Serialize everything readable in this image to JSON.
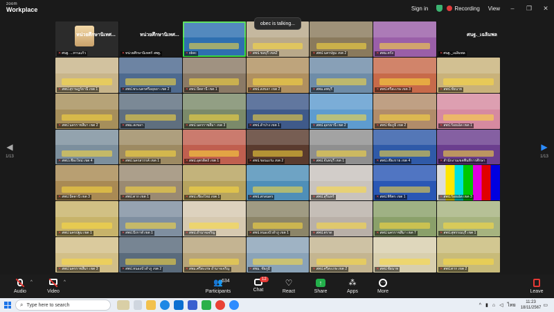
{
  "app": {
    "brand_line1": "zoom",
    "brand_line2": "Workplace"
  },
  "topbar": {
    "sign_in": "Sign in",
    "recording": "Recording",
    "view": "View",
    "minimize": "–",
    "restore": "❐",
    "close": "✕"
  },
  "talking": "obec is talking...",
  "nav": {
    "left_page": "1/13",
    "right_page": "1/13"
  },
  "tiles": [
    {
      "label": "ศนฐ. ...ทานแก้ว",
      "kind": "presenter",
      "color": "#2b2b2b",
      "banner": "หน่วยศึกษานิเทศ..."
    },
    {
      "label": "หน่วยศึกษานิเทศก์ สพฐ.",
      "kind": "banner",
      "color": "#1a1a1a",
      "banner": "หน่วยศึกษานิเทศ..."
    },
    {
      "label": "obec",
      "kind": "active",
      "color": "#2e6fb0"
    },
    {
      "label": "สพป.ชลบุรี เขต2",
      "kind": "room",
      "color": "#b9a98a"
    },
    {
      "label": "สพป.นครปฐม เขต 2",
      "kind": "room",
      "color": "#8a7a5c"
    },
    {
      "label": "สพม.ตรัง",
      "kind": "room",
      "color": "#9a5fa8"
    },
    {
      "label": "ศนฐ._เฉลิมพล",
      "kind": "banner",
      "color": "#1a1a1a",
      "banner": "ศนฐ._เฉลิมพล"
    },
    {
      "label": "สพป.สุราษฎร์ธานี เขต 1",
      "kind": "room",
      "color": "#c8b58a"
    },
    {
      "label": "สพป.พระนครศรีอยุธยา เขต 2",
      "kind": "room",
      "color": "#4e6a8f"
    },
    {
      "label": "สพป.ปัตตานี เขต 1",
      "kind": "room",
      "color": "#8b7a66"
    },
    {
      "label": "สพป.สงขลา เขต 2",
      "kind": "room",
      "color": "#b09060"
    },
    {
      "label": "สพม.ลพบุรี",
      "kind": "room",
      "color": "#6e8ca8"
    },
    {
      "label": "สพป.ศรีสะเกษ เขต 3",
      "kind": "room",
      "color": "#c76a4a"
    },
    {
      "label": "สพป.ชัยนาท",
      "kind": "room",
      "color": "#c9b27a"
    },
    {
      "label": "สพป.นครราชสีมา เขต 2",
      "kind": "room",
      "color": "#a68f5b"
    },
    {
      "label": "สพม.สงขลา",
      "kind": "room",
      "color": "#5f6f7f"
    },
    {
      "label": "สพป.นครราชสีมา เขต 3",
      "kind": "room",
      "color": "#7b8a6a"
    },
    {
      "label": "สพป.ลำปาง เขต 1",
      "kind": "room",
      "color": "#3f5a8a"
    },
    {
      "label": "สพป.อุดรธานี เขต 2",
      "kind": "room",
      "color": "#5e9ccf"
    },
    {
      "label": "สพป.ชัยภูมิ เขต 2",
      "kind": "room",
      "color": "#b18c6a"
    },
    {
      "label": "สพป.ร้อยเอ็ด เขต 1",
      "kind": "room",
      "color": "#d68aa0"
    },
    {
      "label": "สพป.เชียงใหม่ เขต 4",
      "kind": "room",
      "color": "#7c8f9d"
    },
    {
      "label": "สพป.นครสวรรค์ เขต 1",
      "kind": "room",
      "color": "#9d8a62"
    },
    {
      "label": "สพป.อุตรดิตถ์ เขต 1",
      "kind": "room",
      "color": "#c05f4f"
    },
    {
      "label": "สพป.ขอนแก่น เขต 2",
      "kind": "room",
      "color": "#5a3b2e"
    },
    {
      "label": "สพป.จันทบุรี เขต 1",
      "kind": "room",
      "color": "#8f8f8f"
    },
    {
      "label": "สพป.เชียงราย เขต 4",
      "kind": "room",
      "color": "#2f5aa8"
    },
    {
      "label": "สำนักงานเขตพื้นที่การศึกษา",
      "kind": "room",
      "color": "#6b3e8e"
    },
    {
      "label": "สพป.ปัตตานี เขต 3",
      "kind": "room",
      "color": "#a98a54"
    },
    {
      "label": "สพป.ตาก เขต 1",
      "kind": "room",
      "color": "#9a8a72"
    },
    {
      "label": "สพป.เชียงใหม่ เขต 1",
      "kind": "room",
      "color": "#b6a35f"
    },
    {
      "label": "สพป.สกลนคร",
      "kind": "room",
      "color": "#4f8fb8"
    },
    {
      "label": "สพป.สุรินทร์",
      "kind": "room",
      "color": "#c9c3bd"
    },
    {
      "label": "สพป.พิจิตร เขต 1",
      "kind": "room",
      "color": "#2a57b5"
    },
    {
      "label": "สพป.ร้อยเอ็ด เขต 3",
      "kind": "bars",
      "color": "#ffffff"
    },
    {
      "label": "สพป.นครปฐม เขต 1",
      "kind": "room",
      "color": "#c7b36a"
    },
    {
      "label": "สพป.บึงกาฬ เขต 1",
      "kind": "room",
      "color": "#7f8fa0"
    },
    {
      "label": "สพป.อำนาจเจริญ",
      "kind": "room",
      "color": "#d6c9b0"
    },
    {
      "label": "สพป.หนองบัวลำภู เขต 1",
      "kind": "room",
      "color": "#8c8568"
    },
    {
      "label": "สพป.ตราด",
      "kind": "room",
      "color": "#b9b0a8"
    },
    {
      "label": "สพป.นครราชสีมา เขต 7",
      "kind": "room",
      "color": "#8aa06a"
    },
    {
      "label": "สพป.สุพรรณบุรี เขต 1",
      "kind": "room",
      "color": "#a6b37f"
    },
    {
      "label": "สพป.นครราชสีมา เขต 3",
      "kind": "room",
      "color": "#d2bf88"
    },
    {
      "label": "สพป.หนองบัวลำภู เขต 2",
      "kind": "room",
      "color": "#5a6b7c"
    },
    {
      "label": "สพม.ศรีสะเกษ อำนาจเจริญ",
      "kind": "room",
      "color": "#b7a47a"
    },
    {
      "label": "สพม. ชัยภูมิ",
      "kind": "room",
      "color": "#8aa3b8"
    },
    {
      "label": "สพป.ศรีสะเกษ เขต 2",
      "kind": "room",
      "color": "#c4b590"
    },
    {
      "label": "สพป.ชัยนาท",
      "kind": "room",
      "color": "#d8cfae"
    },
    {
      "label": "สพป.ตาก เขต 2",
      "kind": "room",
      "color": "#c8bb79"
    }
  ],
  "toolbar": {
    "audio": "Audio",
    "video": "Video",
    "participants": "Participants",
    "participants_count": "634",
    "chat": "Chat",
    "chat_badge": "12",
    "react": "React",
    "share": "Share",
    "apps": "Apps",
    "more": "More",
    "leave": "Leave"
  },
  "taskbar": {
    "search_placeholder": "Type here to search",
    "lang": "ไทย",
    "time": "11:23",
    "date": "18/11/2567"
  }
}
